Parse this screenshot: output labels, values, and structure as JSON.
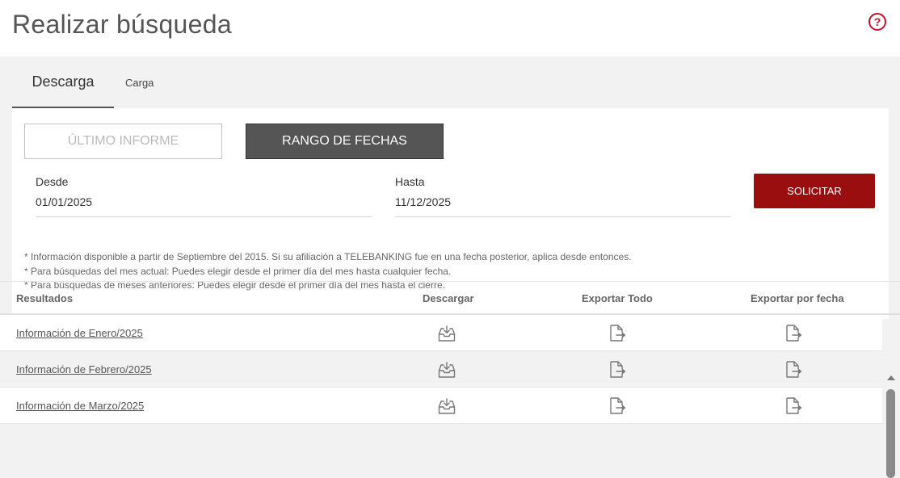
{
  "page": {
    "title": "Realizar búsqueda",
    "help_icon": "?"
  },
  "tabs": [
    {
      "label": "Descarga",
      "active": true
    },
    {
      "label": "Carga",
      "active": false
    }
  ],
  "mode_buttons": {
    "ultimo_informe": "ÚLTIMO INFORME",
    "rango_fechas": "RANGO DE FECHAS",
    "selected": "RANGO DE FECHAS"
  },
  "form": {
    "desde_label": "Desde",
    "desde_value": "01/01/2025",
    "hasta_label": "Hasta",
    "hasta_value": "11/12/2025",
    "solicitar_label": "SOLICITAR"
  },
  "notes": [
    "* Información disponible a partir de Septiembre del 2015. Si su afiliación a TELEBANKING fue en una fecha posterior, aplica desde entonces.",
    "* Para búsquedas del mes actual: Puedes elegir desde el primer día del mes hasta cualquier fecha.",
    "* Para búsquedas de meses anteriores: Puedes elegir desde el primer día del mes hasta el cierre."
  ],
  "results": {
    "headers": [
      "Resultados",
      "Descargar",
      "Exportar Todo",
      "Exportar por fecha"
    ],
    "rows": [
      {
        "label": "Información de Enero/2025"
      },
      {
        "label": "Información de Febrero/2025"
      },
      {
        "label": "Información de Marzo/2025"
      }
    ]
  },
  "icons": {
    "help": "help-icon",
    "download": "download-tray-icon",
    "export": "file-export-icon"
  },
  "colors": {
    "accent_red": "#9b0e10",
    "help_red": "#c8102e",
    "selected_button": "#555555"
  }
}
